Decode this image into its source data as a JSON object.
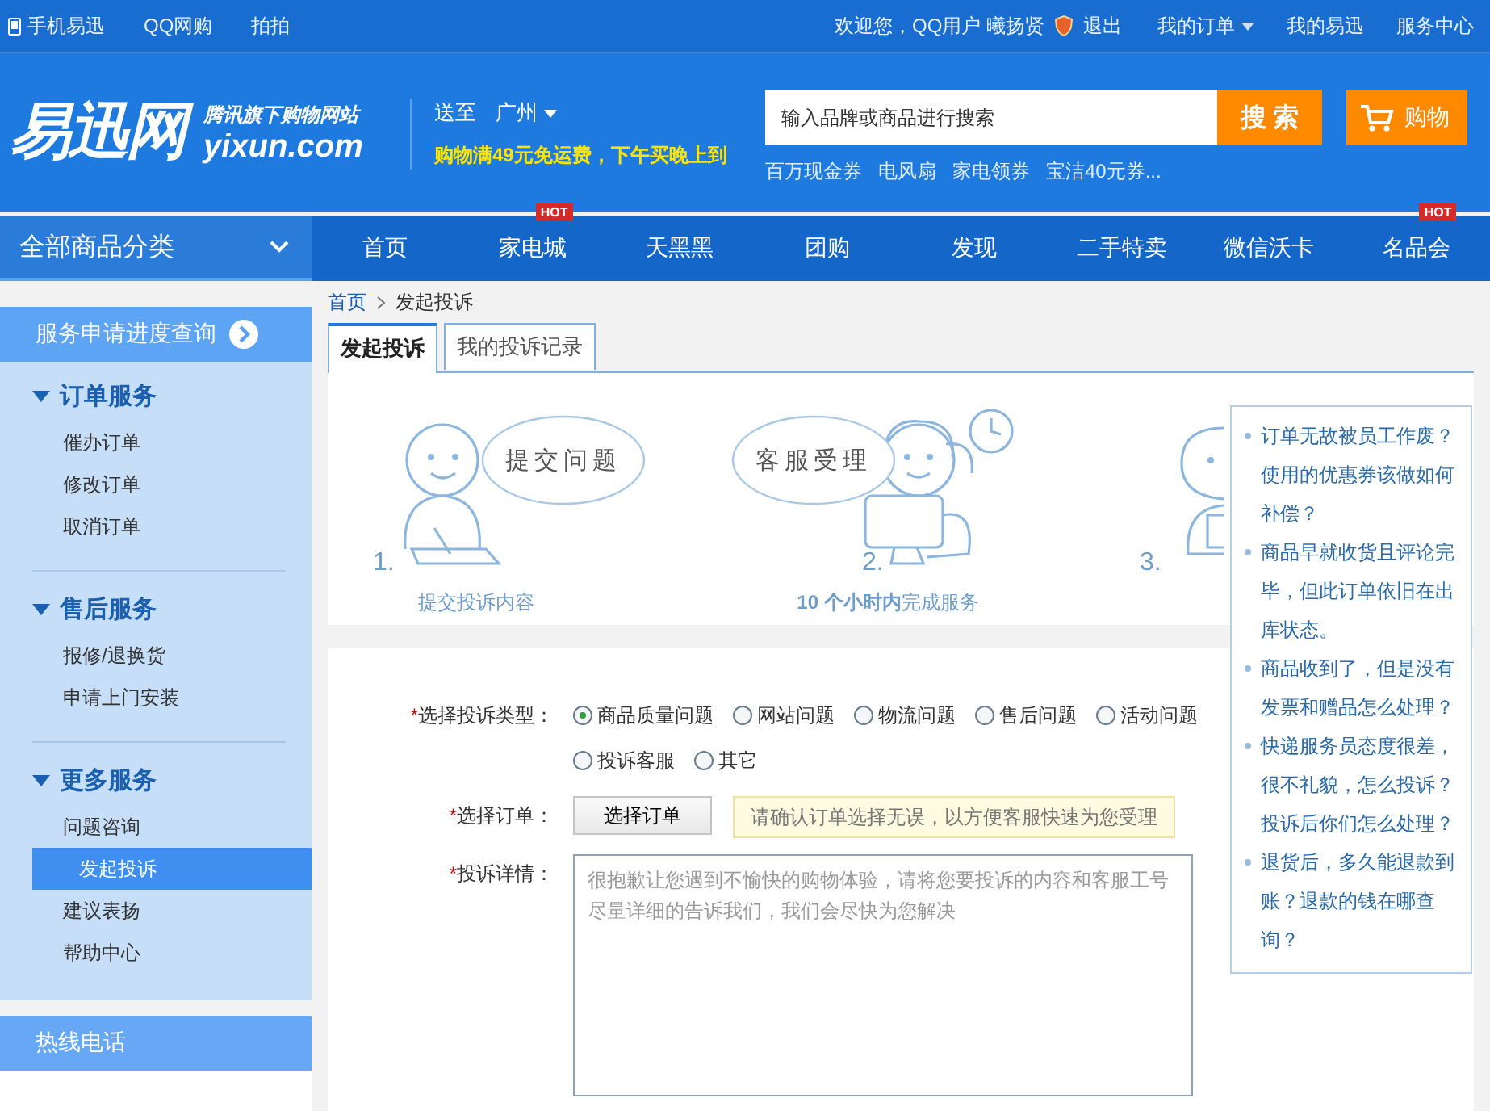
{
  "top_bar": {
    "mobile_link": "手机易迅",
    "links": [
      "QQ网购",
      "拍拍"
    ],
    "welcome": "欢迎您，QQ用户 曦扬贤",
    "logout": "退出",
    "menus": [
      {
        "label": "我的订单",
        "dropdown": true
      },
      {
        "label": "我的易迅",
        "dropdown": false
      },
      {
        "label": "服务中心",
        "dropdown": false
      }
    ]
  },
  "header": {
    "logo": "易迅网",
    "slogan": "腾讯旗下购物网站",
    "domain": "yixun.com",
    "deliver_label": "送至",
    "city": "广州",
    "promo": "购物满49元免运费，下午买晚上到",
    "search": {
      "placeholder": "输入品牌或商品进行搜索",
      "button": "搜 索"
    },
    "hot_keywords": [
      "百万现金券",
      "电风扇",
      "家电领券",
      "宝洁40元券..."
    ],
    "cart": "购物"
  },
  "nav": {
    "category": "全部商品分类",
    "items": [
      {
        "label": "首页"
      },
      {
        "label": "家电城",
        "badge": "HOT"
      },
      {
        "label": "天黑黑"
      },
      {
        "label": "团购"
      },
      {
        "label": "发现"
      },
      {
        "label": "二手特卖"
      },
      {
        "label": "微信沃卡"
      },
      {
        "label": "名品会",
        "badge": "HOT"
      }
    ]
  },
  "sidebar": {
    "progress_button": "服务申请进度查询",
    "groups": [
      {
        "title": "订单服务",
        "expanded": true,
        "items": [
          {
            "label": "催办订单",
            "selected": false
          },
          {
            "label": "修改订单",
            "selected": false
          },
          {
            "label": "取消订单",
            "selected": false
          }
        ]
      },
      {
        "title": "售后服务",
        "expanded": true,
        "items": [
          {
            "label": "报修/退换货",
            "selected": false
          },
          {
            "label": "申请上门安装",
            "selected": false
          }
        ]
      },
      {
        "title": "更多服务",
        "expanded": true,
        "items": [
          {
            "label": "问题咨询",
            "selected": false
          },
          {
            "label": "发起投诉",
            "selected": true
          },
          {
            "label": "建议表扬",
            "selected": false
          },
          {
            "label": "帮助中心",
            "selected": false
          }
        ]
      }
    ],
    "hotline": "热线电话"
  },
  "breadcrumb": [
    "首页",
    "发起投诉"
  ],
  "tabs": [
    {
      "label": "发起投诉",
      "selected": true
    },
    {
      "label": "我的投诉记录",
      "selected": false
    }
  ],
  "steps": [
    {
      "number": "1.",
      "bubble": "提交问题",
      "caption": "提交投诉内容"
    },
    {
      "number": "2.",
      "bubble": "客服受理",
      "caption": "**10 个小时内**完成服务"
    },
    {
      "number": "3."
    }
  ],
  "form": {
    "type_label": "选择投诉类型：",
    "type_mark": "*",
    "types": [
      {
        "label": "商品质量问题",
        "selected": true
      },
      {
        "label": "网站问题",
        "selected": false
      },
      {
        "label": "物流问题",
        "selected": false
      },
      {
        "label": "售后问题",
        "selected": false
      },
      {
        "label": "活动问题",
        "selected": false
      },
      {
        "label": "投诉客服",
        "selected": false
      },
      {
        "label": "其它",
        "selected": false
      }
    ],
    "order_label": "选择订单：",
    "order_mark": "*",
    "order_button": "选择订单",
    "order_tip": "请确认订单选择无误，以方便客服快速为您受理",
    "detail_label": "投诉详情：",
    "detail_mark": "*",
    "detail_placeholder": "很抱歉让您遇到不愉快的购物体验，请将您要投诉的内容和客服工号尽量详细的告诉我们，我们会尽快为您解决"
  },
  "faq_popup": [
    "订单无故被员工作废？使用的优惠券该做如何补偿？",
    "商品早就收货且评论完毕，但此订单依旧在出库状态。",
    "商品收到了，但是没有发票和赠品怎么处理？",
    "快递服务员态度很差，很不礼貌，怎么投诉？投诉后你们怎么处理？",
    "退货后，多久能退款到账？退款的钱在哪查询？"
  ]
}
